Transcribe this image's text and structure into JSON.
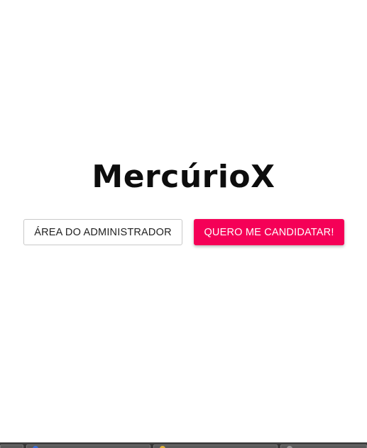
{
  "app": {
    "title": "MercúrioX"
  },
  "actions": {
    "admin_label": "ÁREA DO ADMINISTRADOR",
    "apply_label": "QUERO ME CANDIDATAR!"
  },
  "colors": {
    "primary_accent": "#f50057",
    "title_text": "#0d0d0d",
    "background": "#ffffff"
  },
  "taskbar": {
    "items": [
      {
        "icon": "app-icon"
      },
      {
        "icon": "browser-icon"
      },
      {
        "icon": "folder-icon"
      },
      {
        "icon": "window-icon"
      }
    ]
  }
}
